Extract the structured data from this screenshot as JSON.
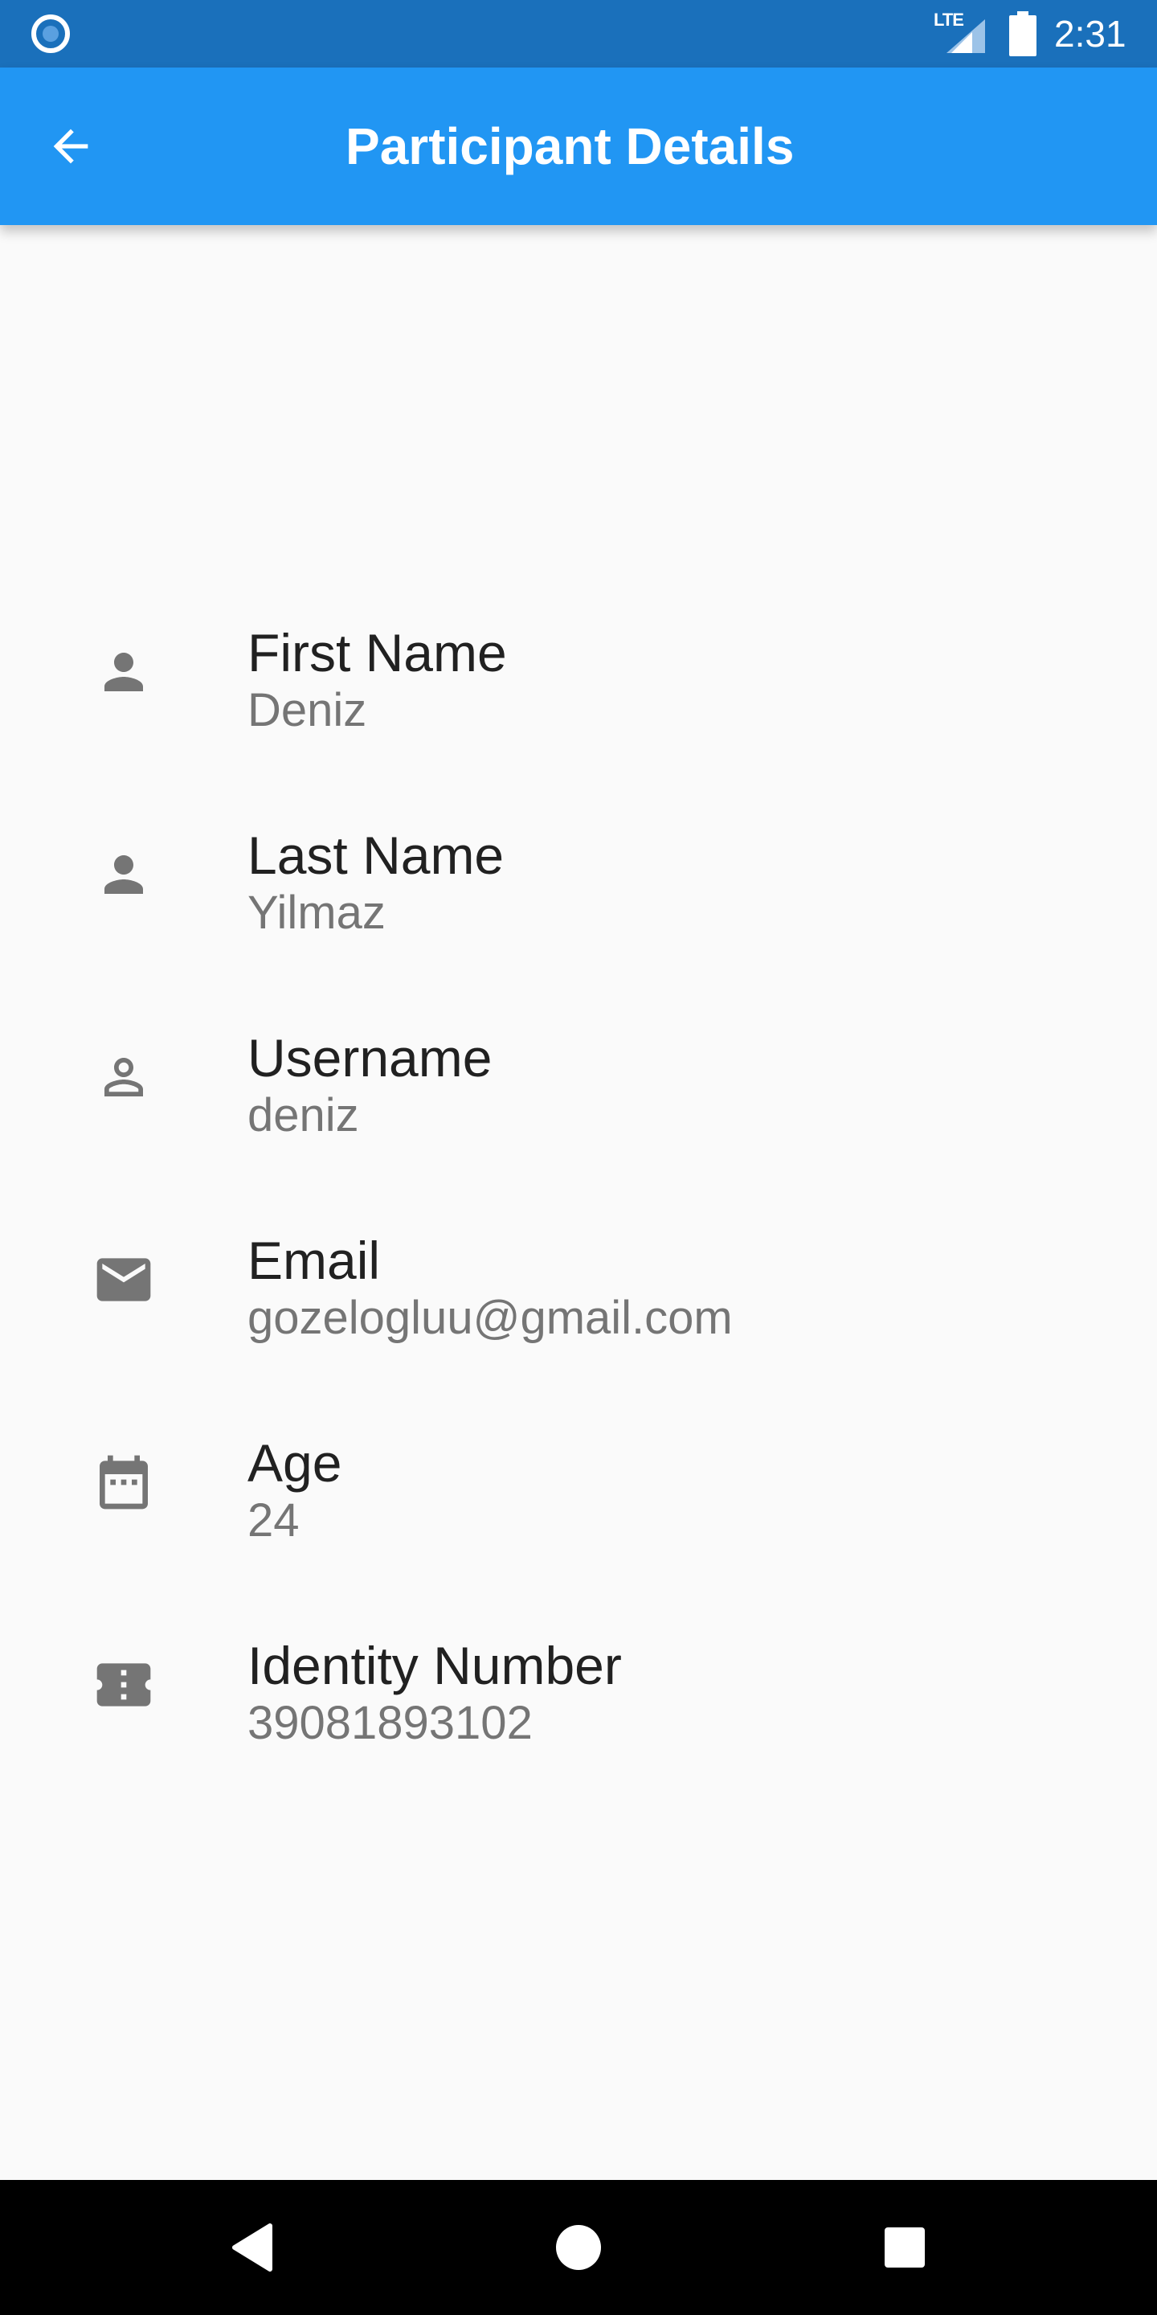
{
  "status_bar": {
    "network": "LTE",
    "time": "2:31"
  },
  "app_bar": {
    "title": "Participant Details",
    "back_icon": "arrow-back-icon"
  },
  "details": [
    {
      "icon": "person-icon",
      "label": "First Name",
      "value": "Deniz"
    },
    {
      "icon": "person-icon",
      "label": "Last Name",
      "value": "Yilmaz"
    },
    {
      "icon": "person-outline-icon",
      "label": "Username",
      "value": "deniz"
    },
    {
      "icon": "email-icon",
      "label": "Email",
      "value": "gozelogluu@gmail.com"
    },
    {
      "icon": "calendar-icon",
      "label": "Age",
      "value": "24"
    },
    {
      "icon": "ticket-icon",
      "label": "Identity Number",
      "value": "39081893102"
    }
  ],
  "nav_bar": {
    "back_icon": "nav-back-icon",
    "home_icon": "nav-home-icon",
    "recents_icon": "nav-recents-icon"
  },
  "colors": {
    "status_bar": "#1a70bb",
    "app_bar": "#2196f3",
    "background": "#fafafa",
    "icon": "#757575",
    "title_text": "#212121",
    "value_text": "#757575"
  }
}
